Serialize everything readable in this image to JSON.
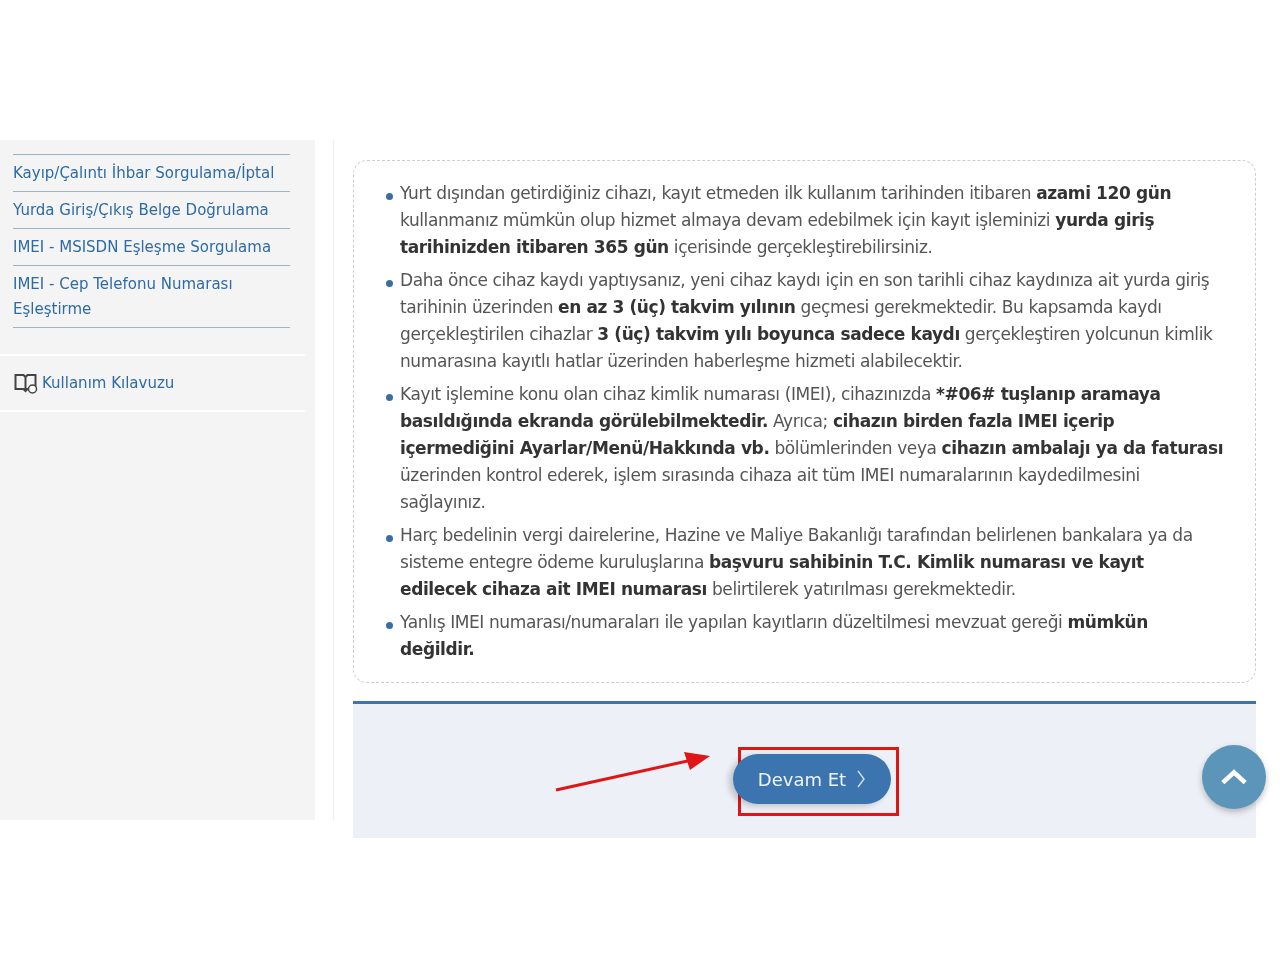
{
  "sidebar": {
    "links": [
      "Kayıp/Çalıntı İhbar Sorgulama/İptal",
      "Yurda Giriş/Çıkış Belge Doğrulama",
      "IMEI - MSISDN Eşleşme Sorgulama",
      "IMEI - Cep Telefonu Numarası Eşleştirme"
    ],
    "guide_link": "Kullanım Kılavuzu"
  },
  "notes": [
    "Yurt dışından getirdiğiniz cihazı, kayıt etmeden ilk kullanım tarihinden itibaren **azami 120 gün** kullanmanız mümkün olup hizmet almaya devam edebilmek için kayıt işleminizi **yurda giriş tarihinizden itibaren 365 gün** içerisinde gerçekleştirebilirsiniz.",
    "Daha önce cihaz kaydı yaptıysanız, yeni cihaz kaydı için en son tarihli cihaz kaydınıza ait yurda giriş tarihinin üzerinden **en az 3 (üç) takvim yılının** geçmesi gerekmektedir. Bu kapsamda kaydı gerçekleştirilen cihazlar **3 (üç) takvim yılı boyunca sadece kaydı** gerçekleştiren yolcunun kimlik numarasına kayıtlı hatlar üzerinden haberleşme hizmeti alabilecektir.",
    "Kayıt işlemine konu olan cihaz kimlik numarası (IMEI), cihazınızda ***#06# tuşlanıp aramaya basıldığında ekranda görülebilmektedir.** Ayrıca; **cihazın birden fazla IMEI içerip içermediğini Ayarlar/Menü/Hakkında vb.** bölümlerinden veya **cihazın ambalajı ya da faturası** üzerinden kontrol ederek, işlem sırasında cihaza ait tüm IMEI numaralarının kaydedilmesini sağlayınız.",
    "Harç bedelinin vergi dairelerine, Hazine ve Maliye Bakanlığı tarafından belirlenen bankalara ya da sisteme entegre ödeme kuruluşlarına **başvuru sahibinin T.C. Kimlik numarası ve kayıt edilecek cihaza ait IMEI numarası** belirtilerek yatırılması gerekmektedir.",
    "Yanlış IMEI numarası/numaraları ile yapılan kayıtların düzeltilmesi mevzuat gereği **mümkün değildir.**"
  ],
  "continue_button": {
    "label": "Devam Et"
  }
}
